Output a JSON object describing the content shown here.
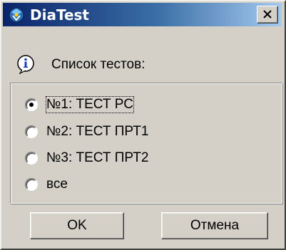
{
  "window": {
    "title": "DiaTest"
  },
  "header": {
    "icon": "info-icon",
    "label": "Список тестов:"
  },
  "tests": [
    {
      "label": "№1: ТЕСТ РС",
      "selected": true
    },
    {
      "label": "№2: ТЕСТ ПРТ1",
      "selected": false
    },
    {
      "label": "№3: ТЕСТ ПРТ2",
      "selected": false
    },
    {
      "label": "все",
      "selected": false
    }
  ],
  "buttons": {
    "ok": "OK",
    "cancel": "Отмена"
  },
  "colors": {
    "title_start": "#0a246a",
    "title_end": "#a6caf0",
    "face": "#d4d0c8"
  }
}
